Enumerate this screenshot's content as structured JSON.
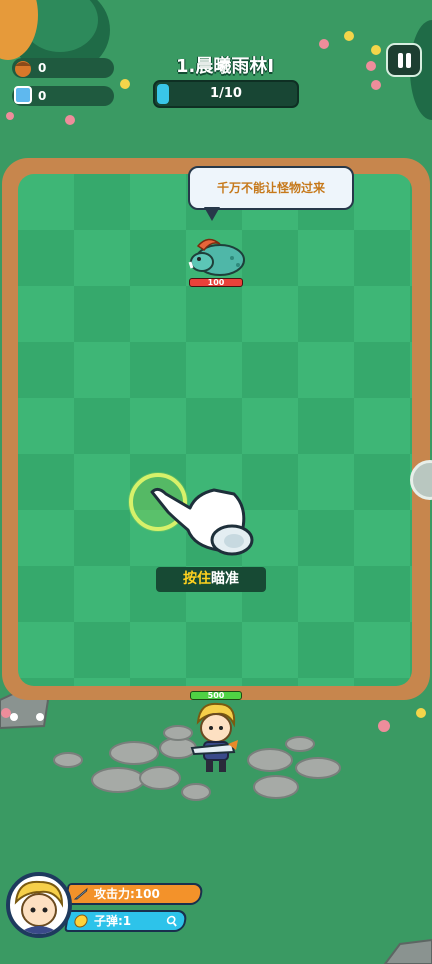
{
  "hud": {
    "resources": [
      {
        "name": "acorn",
        "value": "0",
        "icon": "acorn-icon"
      },
      {
        "name": "gem",
        "value": "0",
        "icon": "blue-gem-icon"
      }
    ],
    "level_title": "1.晨曦雨林I",
    "progress": {
      "text": "1/10",
      "current": 1,
      "total": 10
    },
    "pause_icon": "pause-icon"
  },
  "arena": {
    "speech": "千万不能让怪物过来",
    "enemy": {
      "type": "boar-monster",
      "hp": "100"
    },
    "hold_label_highlight": "按住",
    "hold_label_rest": "瞄准"
  },
  "player": {
    "hp": "500"
  },
  "stats": {
    "attack": "攻击力:100",
    "ammo": "子弹:1"
  },
  "colors": {
    "field": "#3eb676",
    "field_dark": "#36a96c",
    "border": "#c7864d",
    "progress_fill": "#39c6e8",
    "attack_bg": "#f3922a",
    "ammo_bg": "#2dc3ea"
  }
}
